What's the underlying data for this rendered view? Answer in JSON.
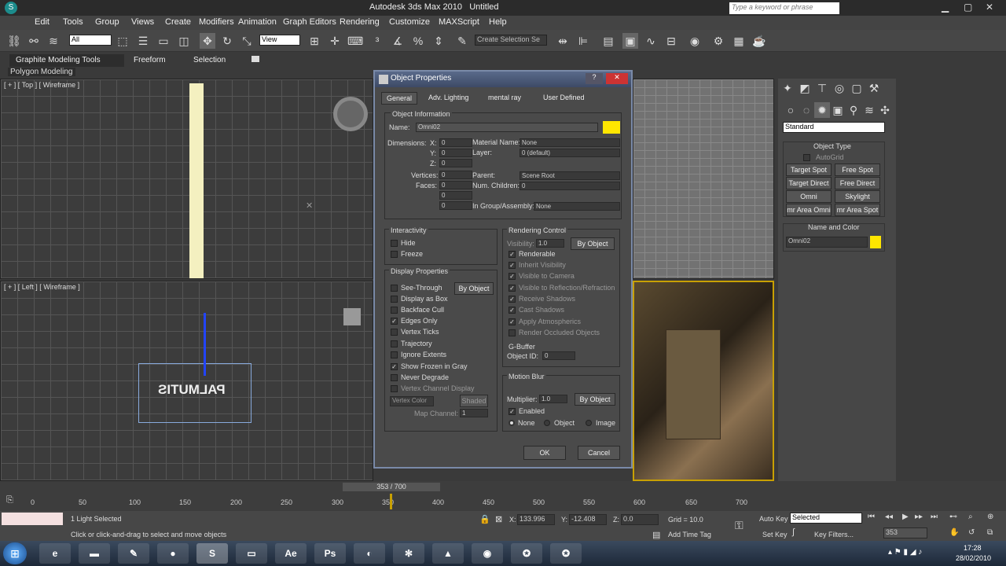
{
  "app": {
    "title": "Autodesk 3ds Max 2010",
    "file": "Untitled",
    "search_placeholder": "Type a keyword or phrase"
  },
  "menu": [
    "Edit",
    "Tools",
    "Group",
    "Views",
    "Create",
    "Modifiers",
    "Animation",
    "Graph Editors",
    "Rendering",
    "Customize",
    "MAXScript",
    "Help"
  ],
  "toolbar": {
    "filter": "All",
    "ref_coord": "View",
    "selection_set": "Create Selection Se"
  },
  "ribbon": {
    "tabs": [
      "Graphite Modeling Tools",
      "Freeform",
      "Selection"
    ],
    "sub": "Polygon Modeling"
  },
  "viewports": {
    "top": "[ + ] [ Top ] [ Wireframe ]",
    "left": "[ + ] [ Left ] [ Wireframe ]",
    "text_object": "PALMUTIS"
  },
  "dialog": {
    "title": "Object Properties",
    "tabs": [
      "General",
      "Adv. Lighting",
      "mental ray",
      "User Defined"
    ],
    "object_info": {
      "group": "Object Information",
      "name_label": "Name:",
      "name_value": "Omni02",
      "color": "#ffe600",
      "dim_label": "Dimensions:",
      "x": "X:",
      "y": "Y:",
      "z": "Z:",
      "x_val": "0",
      "y_val": "0",
      "z_val": "0",
      "vertices_label": "Vertices:",
      "vertices": "0",
      "faces_label": "Faces:",
      "faces": "0",
      "extra1": "0",
      "extra2": "0",
      "material_label": "Material Name:",
      "material": "None",
      "layer_label": "Layer:",
      "layer": "0 (default)",
      "parent_label": "Parent:",
      "parent": "Scene Root",
      "children_label": "Num. Children:",
      "children": "0",
      "group_label": "In Group/Assembly:",
      "group_val": "None"
    },
    "interactivity": {
      "title": "Interactivity",
      "items": [
        {
          "label": "Hide",
          "checked": false
        },
        {
          "label": "Freeze",
          "checked": false
        }
      ]
    },
    "display": {
      "title": "Display Properties",
      "by_object": "By Object",
      "items": [
        {
          "label": "See-Through",
          "checked": false
        },
        {
          "label": "Display as Box",
          "checked": false
        },
        {
          "label": "Backface Cull",
          "checked": false
        },
        {
          "label": "Edges Only",
          "checked": true
        },
        {
          "label": "Vertex Ticks",
          "checked": false
        },
        {
          "label": "Trajectory",
          "checked": false
        },
        {
          "label": "Ignore Extents",
          "checked": false
        },
        {
          "label": "Show Frozen in Gray",
          "checked": true
        },
        {
          "label": "Never Degrade",
          "checked": false
        },
        {
          "label": "Vertex Channel Display",
          "checked": false
        }
      ],
      "vertex_color": "Vertex Color",
      "shaded": "Shaded",
      "map_channel_label": "Map Channel:",
      "map_channel": "1"
    },
    "rendering": {
      "title": "Rendering Control",
      "visibility_label": "Visibility:",
      "visibility": "1.0",
      "by_object": "By Object",
      "items": [
        {
          "label": "Renderable",
          "checked": true
        },
        {
          "label": "Inherit Visibility",
          "checked": true
        },
        {
          "label": "Visible to Camera",
          "checked": true
        },
        {
          "label": "Visible to Reflection/Refraction",
          "checked": true
        },
        {
          "label": "Receive Shadows",
          "checked": true
        },
        {
          "label": "Cast Shadows",
          "checked": true
        },
        {
          "label": "Apply Atmospherics",
          "checked": true
        },
        {
          "label": "Render Occluded Objects",
          "checked": false
        }
      ]
    },
    "gbuffer": {
      "title": "G-Buffer",
      "label": "Object ID:",
      "value": "0"
    },
    "motion_blur": {
      "title": "Motion Blur",
      "multiplier_label": "Multiplier:",
      "multiplier": "1.0",
      "by_object": "By Object",
      "enabled": "Enabled",
      "options": [
        "None",
        "Object",
        "Image"
      ],
      "selected": "None"
    },
    "ok": "OK",
    "cancel": "Cancel"
  },
  "command_panel": {
    "dropdown": "Standard",
    "rollout": "Object Type",
    "autogrid": "AutoGrid",
    "buttons": [
      "Target Spot",
      "Free Spot",
      "Target Direct",
      "Free Direct",
      "Omni",
      "Skylight",
      "mr Area Omni",
      "mr Area Spot"
    ],
    "name_color": "Name and Color",
    "name": "Omni02",
    "color": "#ffe600"
  },
  "timeline": {
    "frame": "353 / 700",
    "ticks": [
      "0",
      "50",
      "100",
      "150",
      "200",
      "250",
      "300",
      "350",
      "400",
      "450",
      "500",
      "550",
      "600",
      "650",
      "700"
    ],
    "current": 353
  },
  "status": {
    "selected": "1 Light Selected",
    "prompt": "Click or click-and-drag to select and move objects",
    "x_label": "X:",
    "x": "133.996",
    "y_label": "Y:",
    "y": "-12.408",
    "z_label": "Z:",
    "z": "0.0",
    "grid": "Grid = 10.0",
    "add_time_tag": "Add Time Tag",
    "auto_key": "Auto Key",
    "set_key": "Set Key",
    "key_mode": "Selected",
    "key_filters": "Key Filters...",
    "frame": "353"
  },
  "taskbar": {
    "time": "17:28",
    "date": "28/02/2010",
    "apps": [
      "Ae",
      "Ps"
    ]
  }
}
